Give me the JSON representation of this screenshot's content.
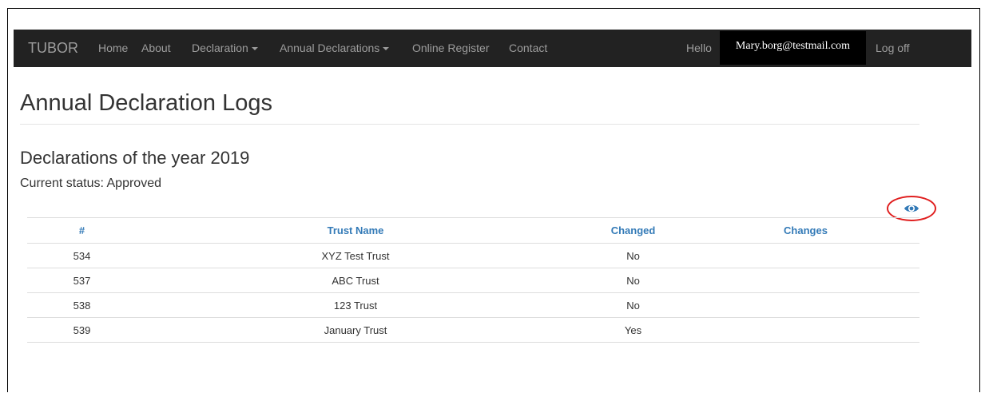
{
  "navbar": {
    "brand": "TUBOR",
    "items": [
      {
        "label": "Home"
      },
      {
        "label": "About"
      },
      {
        "label": "Declaration"
      },
      {
        "label": "Annual Declarations"
      },
      {
        "label": "Online Register"
      },
      {
        "label": "Contact"
      }
    ],
    "greeting": "Hello",
    "user_email": "Mary.borg@testmail.com",
    "logoff_label": "Log off"
  },
  "page": {
    "title": "Annual Declaration Logs",
    "section_title": "Declarations of the year 2019",
    "status_text": "Current status: Approved"
  },
  "icons": {
    "view": "eye-icon",
    "dropdown": "caret-down-icon"
  },
  "colors": {
    "navbar_bg": "#222222",
    "link": "#337ab7",
    "highlight_circle": "#e02020"
  },
  "table": {
    "headers": [
      "#",
      "Trust Name",
      "Changed",
      "Changes"
    ],
    "rows": [
      {
        "id": "534",
        "trust_name": "XYZ Test Trust",
        "changed": "No",
        "changes": ""
      },
      {
        "id": "537",
        "trust_name": "ABC Trust",
        "changed": "No",
        "changes": ""
      },
      {
        "id": "538",
        "trust_name": "123 Trust",
        "changed": "No",
        "changes": ""
      },
      {
        "id": "539",
        "trust_name": "January Trust",
        "changed": "Yes",
        "changes": ""
      }
    ]
  }
}
